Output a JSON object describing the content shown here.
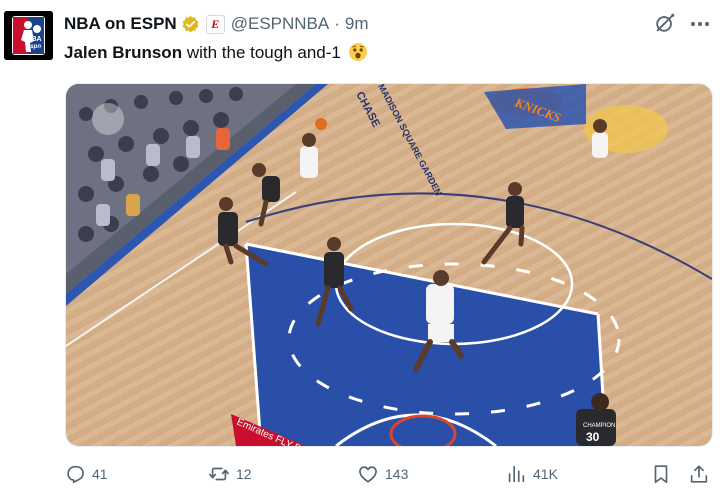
{
  "author": {
    "name": "NBA on ESPN",
    "handle": "@ESPNNBA",
    "separator": "·",
    "time": "9m",
    "avatar_text": "NBA",
    "avatar_subtext": "espn",
    "affiliate_badge": "E"
  },
  "tweet": {
    "player": "Jalen Brunson",
    "text": " with the tough and-1",
    "emoji": "astonished-face-emoji"
  },
  "media": {
    "kind": "basketball game video frame",
    "court_texts": [
      "CHASE",
      "MADISON SQUARE GARDEN",
      "KNICKS",
      "Emirates FLY BETTER"
    ],
    "jersey_texts": [
      "30",
      "CHAMPION"
    ],
    "colors": {
      "floor": "#d8b38a",
      "paint": "#2a4fa8",
      "knicks_orange": "#f58426"
    }
  },
  "actions": {
    "replies": "41",
    "reposts": "12",
    "likes": "143",
    "views": "41K"
  },
  "colors": {
    "text": "#0f1419",
    "secondary": "#536471",
    "verified_gold": "#e2b719",
    "espn_red": "#dd0000"
  }
}
